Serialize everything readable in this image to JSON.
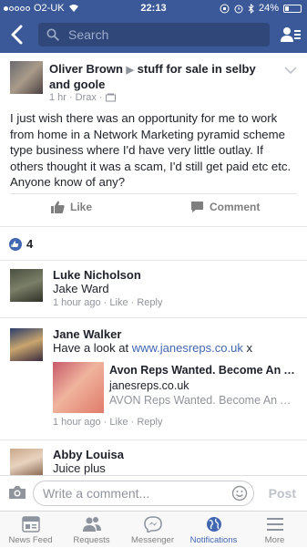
{
  "status_bar": {
    "carrier": "O2-UK",
    "time": "22:13",
    "battery": "24%",
    "battery_level": 0.24
  },
  "nav": {
    "search_placeholder": "Search"
  },
  "post": {
    "author": "Oliver Brown",
    "group": "stuff for sale in selby and goole",
    "time": "1 hr",
    "location": "Drax",
    "body": "I just wish there was an opportunity for me to work from home in a Network Marketing pyramid scheme type business where I'd have very little outlay. If others thought it was a scam, I'd still get paid etc etc. Anyone know of any?"
  },
  "actions": {
    "like": "Like",
    "comment": "Comment"
  },
  "likes": {
    "count": "4"
  },
  "comments": [
    {
      "name": "Luke Nicholson",
      "text": "Jake Ward",
      "time": "1 hour ago",
      "like": "Like",
      "reply": "Reply"
    },
    {
      "name": "Jane Walker",
      "text_prefix": "Have a look at ",
      "link": "www.janesreps.co.uk",
      "text_suffix": " x",
      "time": "1 hour ago",
      "like": "Like",
      "reply": "Reply",
      "preview": {
        "title": "Avon Reps Wanted. Become An Avon Rep",
        "domain": "janesreps.co.uk",
        "description": "AVON Reps Wanted. Become An Avon Rep"
      }
    },
    {
      "name": "Abby Louisa",
      "text": "Juice plus"
    }
  ],
  "composer": {
    "placeholder": "Write a comment...",
    "post": "Post"
  },
  "tabs": [
    {
      "label": "News Feed",
      "icon": "news-feed-icon"
    },
    {
      "label": "Requests",
      "icon": "friend-requests-icon"
    },
    {
      "label": "Messenger",
      "icon": "messenger-icon"
    },
    {
      "label": "Notifications",
      "icon": "globe-icon",
      "active": true
    },
    {
      "label": "More",
      "icon": "menu-icon"
    }
  ],
  "colors": {
    "brand": "#3b5998",
    "link": "#4267b2",
    "meta": "#90949c"
  }
}
